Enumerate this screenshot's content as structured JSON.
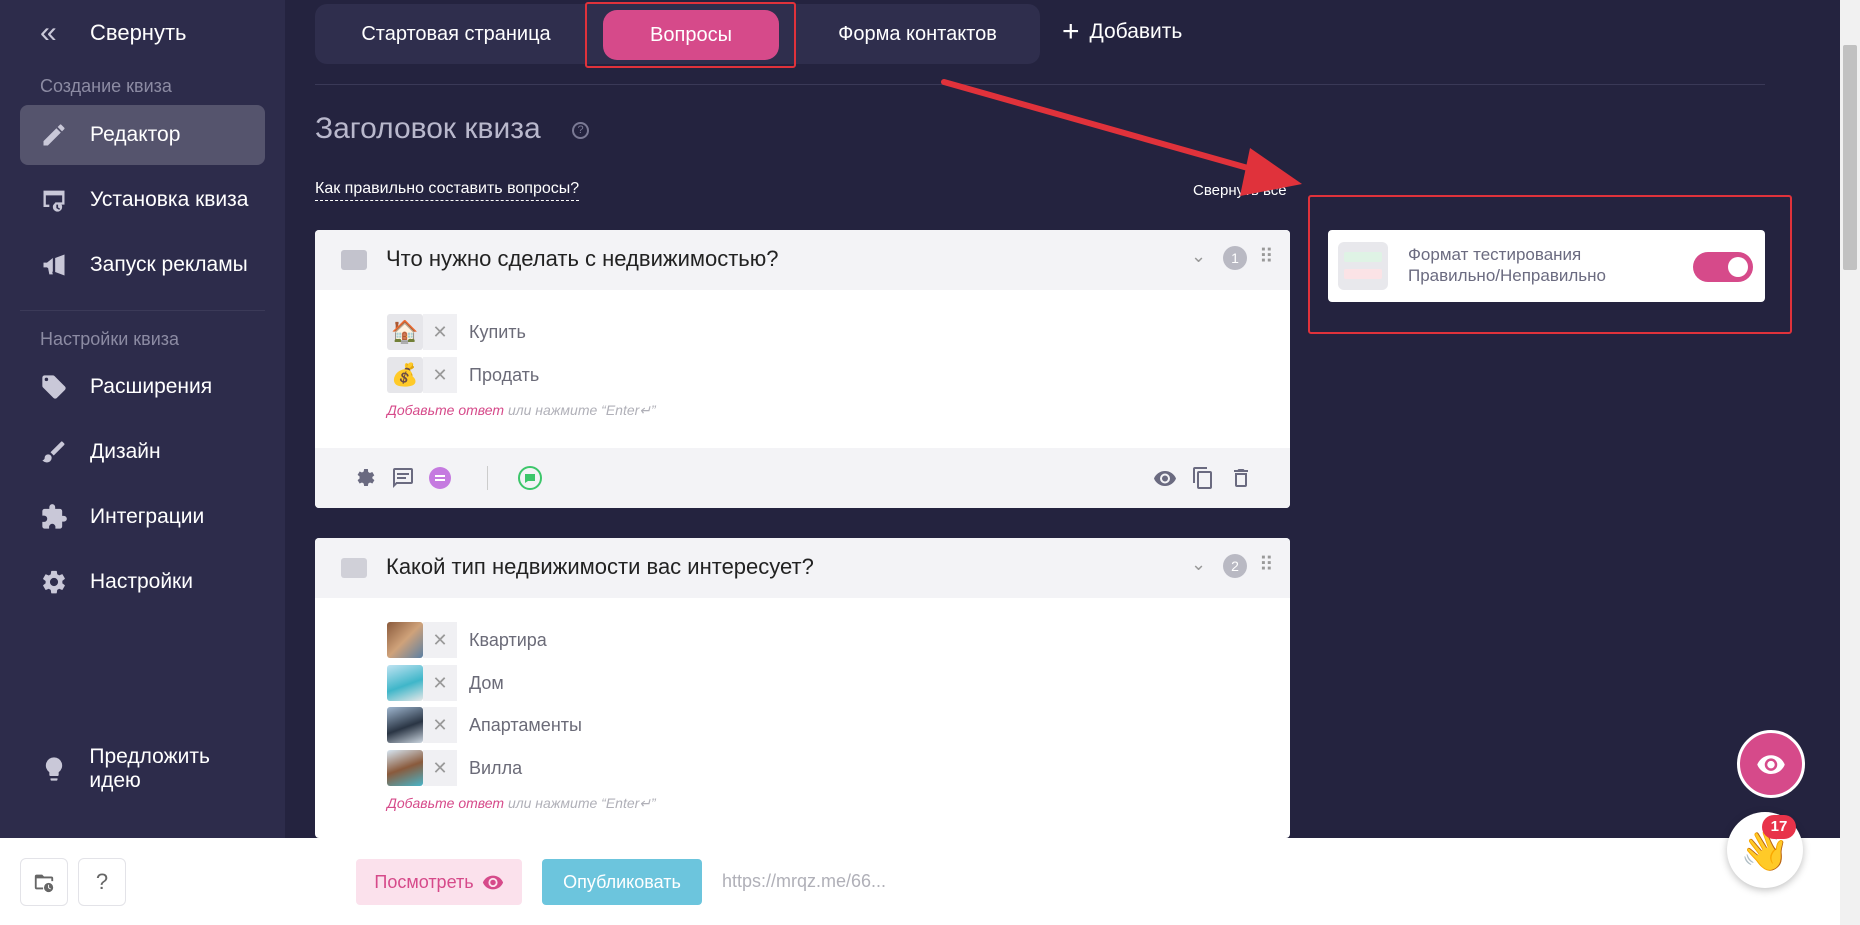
{
  "sidebar": {
    "collapse_label": "Свернуть",
    "section_create": "Создание квиза",
    "items_create": [
      {
        "label": "Редактор",
        "icon": "pencil-icon",
        "active": true
      },
      {
        "label": "Установка квиза",
        "icon": "install-icon"
      },
      {
        "label": "Запуск рекламы",
        "icon": "megaphone-icon"
      }
    ],
    "section_settings": "Настройки квиза",
    "items_settings": [
      {
        "label": "Расширения",
        "icon": "puzzle-tag-icon"
      },
      {
        "label": "Дизайн",
        "icon": "brush-icon"
      },
      {
        "label": "Интеграции",
        "icon": "puzzle-icon"
      },
      {
        "label": "Настройки",
        "icon": "gear-icon"
      }
    ],
    "suggest_label": "Предложить идею"
  },
  "tabs": {
    "start": "Стартовая страница",
    "questions": "Вопросы",
    "contacts": "Форма контактов",
    "add": "Добавить"
  },
  "main": {
    "quiz_title": "Заголовок квиза",
    "how_link": "Как правильно составить вопросы?",
    "collapse_all": "Свернуть все"
  },
  "questions": [
    {
      "title": "Что нужно сделать с недвижимостью?",
      "number": "1",
      "answers": [
        {
          "text": "Купить",
          "image": "🏠"
        },
        {
          "text": "Продать",
          "image": "💰"
        }
      ],
      "add_link": "Добавьте ответ",
      "add_hint": "или нажмите “Enter↵”"
    },
    {
      "title": "Какой тип недвижимости вас интересует?",
      "number": "2",
      "answers": [
        {
          "text": "Квартира"
        },
        {
          "text": "Дом"
        },
        {
          "text": "Апартаменты"
        },
        {
          "text": "Вилла"
        }
      ],
      "add_link": "Добавьте ответ",
      "add_hint": "или нажмите “Enter↵”"
    }
  ],
  "panel": {
    "text_line1": "Формат тестирования",
    "text_line2": "Правильно/Неправильно",
    "toggle_on": true
  },
  "bottom": {
    "help_label": "?",
    "preview_label": "Посмотреть",
    "publish_label": "Опубликовать",
    "url": "https://mrqz.me/66..."
  },
  "notifications": {
    "count": "17"
  },
  "colors": {
    "accent": "#d64a8a",
    "publish": "#6cc5dd",
    "annotation": "#e0323b"
  }
}
